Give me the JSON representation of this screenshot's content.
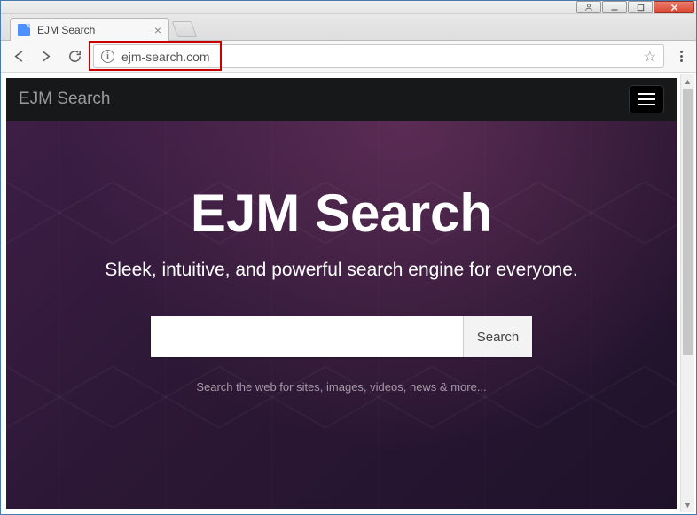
{
  "window": {
    "tab_title": "EJM Search"
  },
  "addressbar": {
    "url": "ejm-search.com"
  },
  "page": {
    "header_brand": "EJM Search",
    "hero_title": "EJM Search",
    "tagline": "Sleek, intuitive, and powerful search engine for everyone.",
    "search_button": "Search",
    "subtext": "Search the web for sites, images, videos, news & more..."
  }
}
